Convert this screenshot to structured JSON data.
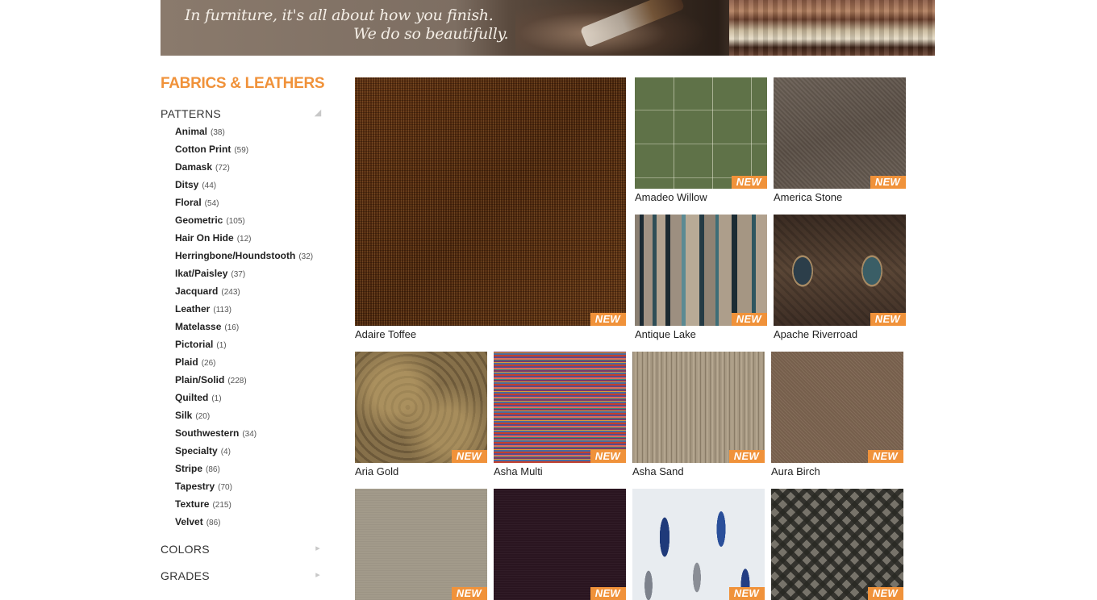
{
  "banner": {
    "line1": "In furniture, it's all about how you finish.",
    "line2": "We do so beautifully."
  },
  "sidebar": {
    "heading": "FABRICS & LEATHERS",
    "patterns": {
      "title": "PATTERNS",
      "toggle_icon": "caret-down-icon",
      "items": [
        {
          "name": "Animal",
          "count": "(38)"
        },
        {
          "name": "Cotton Print",
          "count": "(59)"
        },
        {
          "name": "Damask",
          "count": "(72)"
        },
        {
          "name": "Ditsy",
          "count": "(44)"
        },
        {
          "name": "Floral",
          "count": "(54)"
        },
        {
          "name": "Geometric",
          "count": "(105)"
        },
        {
          "name": "Hair On Hide",
          "count": "(12)"
        },
        {
          "name": "Herringbone/Houndstooth",
          "count": "(32)"
        },
        {
          "name": "Ikat/Paisley",
          "count": "(37)"
        },
        {
          "name": "Jacquard",
          "count": "(243)"
        },
        {
          "name": "Leather",
          "count": "(113)"
        },
        {
          "name": "Matelasse",
          "count": "(16)"
        },
        {
          "name": "Pictorial",
          "count": "(1)"
        },
        {
          "name": "Plaid",
          "count": "(26)"
        },
        {
          "name": "Plain/Solid",
          "count": "(228)"
        },
        {
          "name": "Quilted",
          "count": "(1)"
        },
        {
          "name": "Silk",
          "count": "(20)"
        },
        {
          "name": "Southwestern",
          "count": "(34)"
        },
        {
          "name": "Specialty",
          "count": "(4)"
        },
        {
          "name": "Stripe",
          "count": "(86)"
        },
        {
          "name": "Tapestry",
          "count": "(70)"
        },
        {
          "name": "Texture",
          "count": "(215)"
        },
        {
          "name": "Velvet",
          "count": "(86)"
        }
      ]
    },
    "colors": {
      "title": "COLORS",
      "toggle_icon": "caret-right-icon"
    },
    "grades": {
      "title": "GRADES",
      "toggle_icon": "caret-right-icon"
    }
  },
  "grid": {
    "badge_text": "NEW",
    "badge_color": "#f0923a",
    "tiles": [
      {
        "name": "Adaire Toffee"
      },
      {
        "name": "Amadeo Willow"
      },
      {
        "name": "America Stone"
      },
      {
        "name": "Antique Lake"
      },
      {
        "name": "Apache Riverroad"
      },
      {
        "name": "Aria Gold"
      },
      {
        "name": "Asha Multi"
      },
      {
        "name": "Asha Sand"
      },
      {
        "name": "Aura Birch"
      },
      {
        "name": ""
      },
      {
        "name": ""
      },
      {
        "name": ""
      },
      {
        "name": ""
      }
    ]
  },
  "colors": {
    "accent": "#f0923a",
    "text": "#222222"
  }
}
